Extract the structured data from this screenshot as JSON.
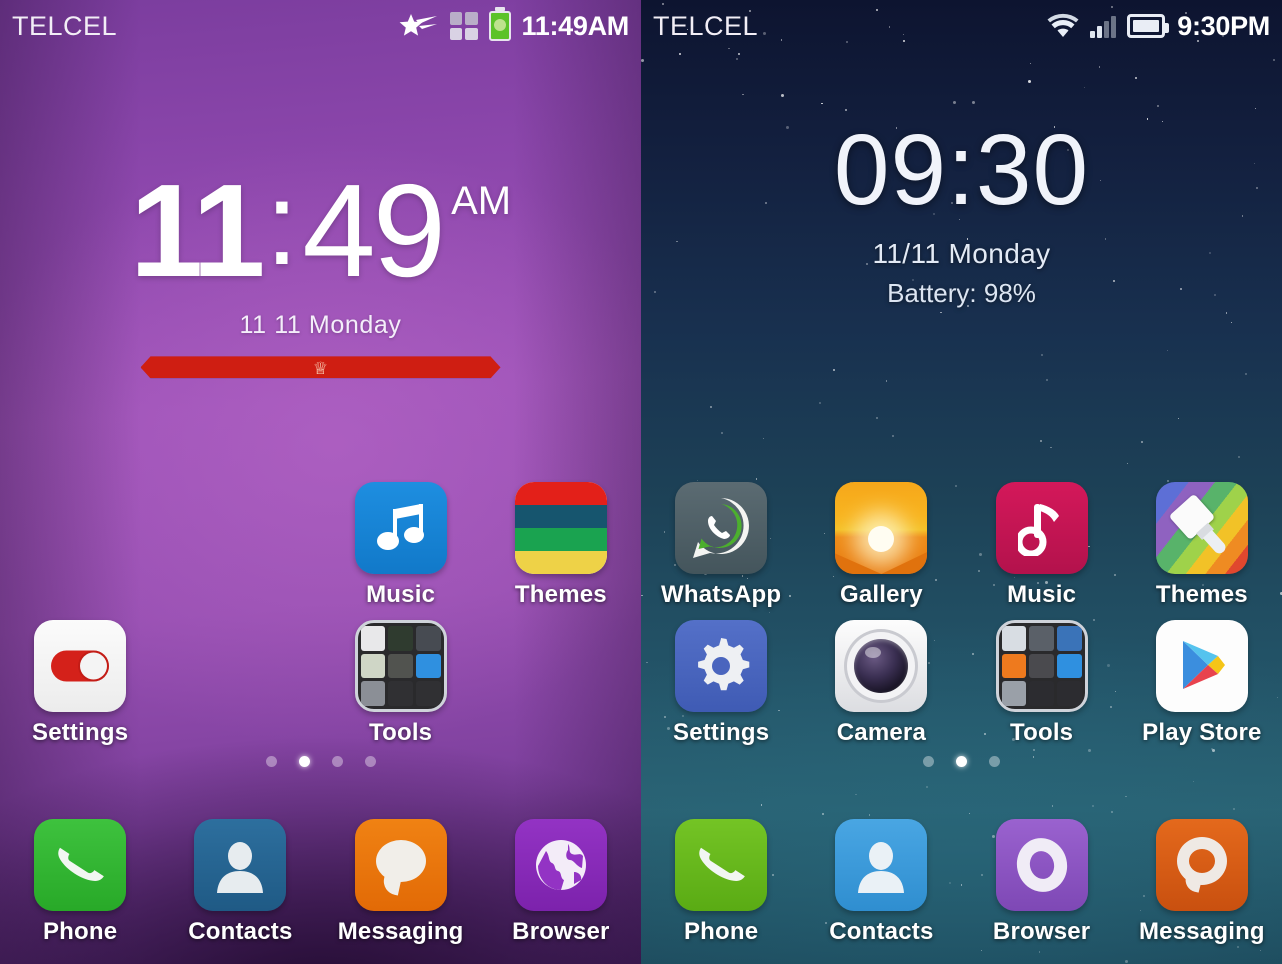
{
  "left_screen": {
    "status_bar": {
      "carrier": "TELCEL",
      "time": "11:49AM",
      "icons": [
        "shooting-star-icon",
        "app-grid-icon",
        "battery-charging-icon"
      ]
    },
    "clock_widget": {
      "hours": "11",
      "separator": ":",
      "minutes": "49",
      "meridiem": "AM",
      "date": "11 11  Monday",
      "ribbon_glyph": "♕"
    },
    "grid_rows": [
      [
        {
          "label": "",
          "icon": "empty",
          "present": false
        },
        {
          "label": "",
          "icon": "empty",
          "present": false
        },
        {
          "label": "Music",
          "icon": "music-note-blue-icon",
          "present": true
        },
        {
          "label": "Themes",
          "icon": "themes-stripes-icon",
          "present": true
        }
      ],
      [
        {
          "label": "Settings",
          "icon": "settings-toggle-icon",
          "present": true
        },
        {
          "label": "",
          "icon": "empty",
          "present": false
        },
        {
          "label": "Tools",
          "icon": "tools-folder-icon",
          "present": true
        },
        {
          "label": "",
          "icon": "empty",
          "present": false
        }
      ]
    ],
    "page_dots": {
      "count": 4,
      "active_index": 1
    },
    "dock": [
      {
        "label": "Phone",
        "icon": "phone-handset-icon"
      },
      {
        "label": "Contacts",
        "icon": "contacts-person-icon"
      },
      {
        "label": "Messaging",
        "icon": "messaging-bubble-icon"
      },
      {
        "label": "Browser",
        "icon": "browser-globe-icon"
      }
    ],
    "colors": {
      "wallpaper_top": "#7b3d9e",
      "wallpaper_mid": "#9d52b8",
      "wallpaper_bottom": "#4c2468",
      "ribbon": "#cf1e12",
      "settings_toggle": "#d4211a",
      "music": "#1e8ee0",
      "phone": "#3ec23e",
      "contacts": "#2d6f9e",
      "messaging": "#f08213",
      "browser": "#9333c4"
    }
  },
  "right_screen": {
    "status_bar": {
      "carrier": "TELCEL",
      "time": "9:30PM",
      "icons": [
        "wifi-icon",
        "signal-bars-icon",
        "battery-icon"
      ]
    },
    "clock_widget": {
      "time": "09:30",
      "date": "11/11 Monday",
      "battery": "Battery: 98%"
    },
    "grid_rows": [
      [
        {
          "label": "WhatsApp",
          "icon": "whatsapp-icon",
          "present": true
        },
        {
          "label": "Gallery",
          "icon": "gallery-sunrise-icon",
          "present": true
        },
        {
          "label": "Music",
          "icon": "music-note-red-icon",
          "present": true
        },
        {
          "label": "Themes",
          "icon": "themes-brush-icon",
          "present": true
        }
      ],
      [
        {
          "label": "Settings",
          "icon": "settings-gear-icon",
          "present": true
        },
        {
          "label": "Camera",
          "icon": "camera-lens-icon",
          "present": true
        },
        {
          "label": "Tools",
          "icon": "tools-folder-icon",
          "present": true
        },
        {
          "label": "Play Store",
          "icon": "play-store-icon",
          "present": true
        }
      ]
    ],
    "page_dots": {
      "count": 3,
      "active_index": 1
    },
    "dock": [
      {
        "label": "Phone",
        "icon": "phone-handset-icon"
      },
      {
        "label": "Contacts",
        "icon": "contacts-person-icon"
      },
      {
        "label": "Browser",
        "icon": "browser-o-icon"
      },
      {
        "label": "Messaging",
        "icon": "messaging-ring-icon"
      }
    ],
    "colors": {
      "wallpaper_top": "#0d1430",
      "wallpaper_mid": "#1d4257",
      "wallpaper_bottom": "#2a6273",
      "whatsapp": "#5b6b72",
      "gallery": "#f6a71a",
      "music": "#d4185a",
      "settings": "#5470c8",
      "play_store": "#fdfdfd",
      "phone": "#74c425",
      "contacts": "#49a6e3",
      "browser": "#9a62cf",
      "messaging": "#e4691c"
    }
  }
}
